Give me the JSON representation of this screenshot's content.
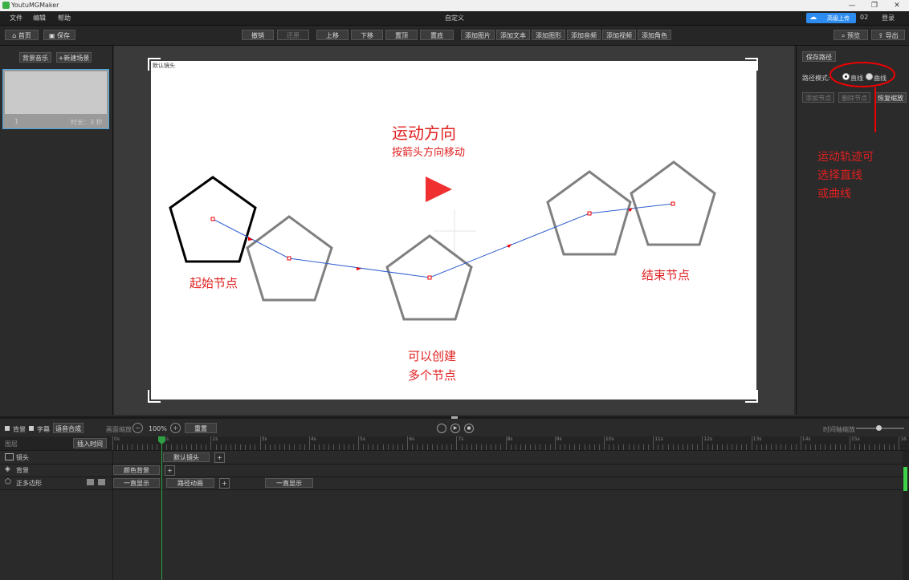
{
  "window": {
    "title": "YoutuMGMaker",
    "min": "—",
    "restore": "❐",
    "close": "✕"
  },
  "menubar": {
    "items": [
      "文件",
      "编辑",
      "帮助"
    ],
    "center_title": "自定义",
    "upload_label": "高级上传",
    "user": "02",
    "login": "登录"
  },
  "toolbar": {
    "home": "首页",
    "save": "保存",
    "undo": "撤销",
    "redo": "还原",
    "up": "上移",
    "down": "下移",
    "top": "置顶",
    "bottom": "置底",
    "add_image": "添加图片",
    "add_text": "添加文本",
    "add_shape": "添加图形",
    "add_audio": "添加音频",
    "add_video": "添加视频",
    "add_role": "添加角色",
    "preview": "预览",
    "export": "导出"
  },
  "left_panel": {
    "bg_music": "背景音乐",
    "new_scene": "+新建场景",
    "scene": {
      "index": "1",
      "duration": "时长：3 秒"
    }
  },
  "stage": {
    "camera_label": "默认镜头",
    "title1": "运动方向",
    "title2": "按箭头方向移动",
    "start_label": "起始节点",
    "end_label": "结束节点",
    "multi_line1": "可以创建",
    "multi_line2": "多个节点"
  },
  "right_panel": {
    "save_path": "保存路径",
    "path_mode_label": "路径模式:",
    "mode_line": "直线",
    "mode_curve": "曲线",
    "add_node": "添加节点",
    "del_node": "删除节点",
    "restore_scale": "恢复缩放",
    "annotation": [
      "运动轨迹可",
      "选择直线",
      "或曲线"
    ]
  },
  "timeline": {
    "chk_audio": "背景",
    "chk_subtitle": "字幕",
    "merge": "语音合成",
    "zoom_label": "画面缩放",
    "zoom_value": "100%",
    "reset": "重置",
    "time_zoom": "时间轴缩放",
    "layer_header": "图层",
    "insert_time": "插入时间",
    "ticks": [
      "0s",
      "1s",
      "2s",
      "3s",
      "4s",
      "5s",
      "6s",
      "7s",
      "8s",
      "9s",
      "10s",
      "11s",
      "12s",
      "13s",
      "14s",
      "15s",
      "16"
    ],
    "rows": [
      {
        "name": "镜头",
        "clips": [
          "默认镜头"
        ]
      },
      {
        "name": "背景",
        "clips": [
          "颜色背景"
        ]
      },
      {
        "name": "正多边形",
        "clips": [
          "一直显示",
          "路径动画",
          "一直显示"
        ]
      }
    ]
  }
}
